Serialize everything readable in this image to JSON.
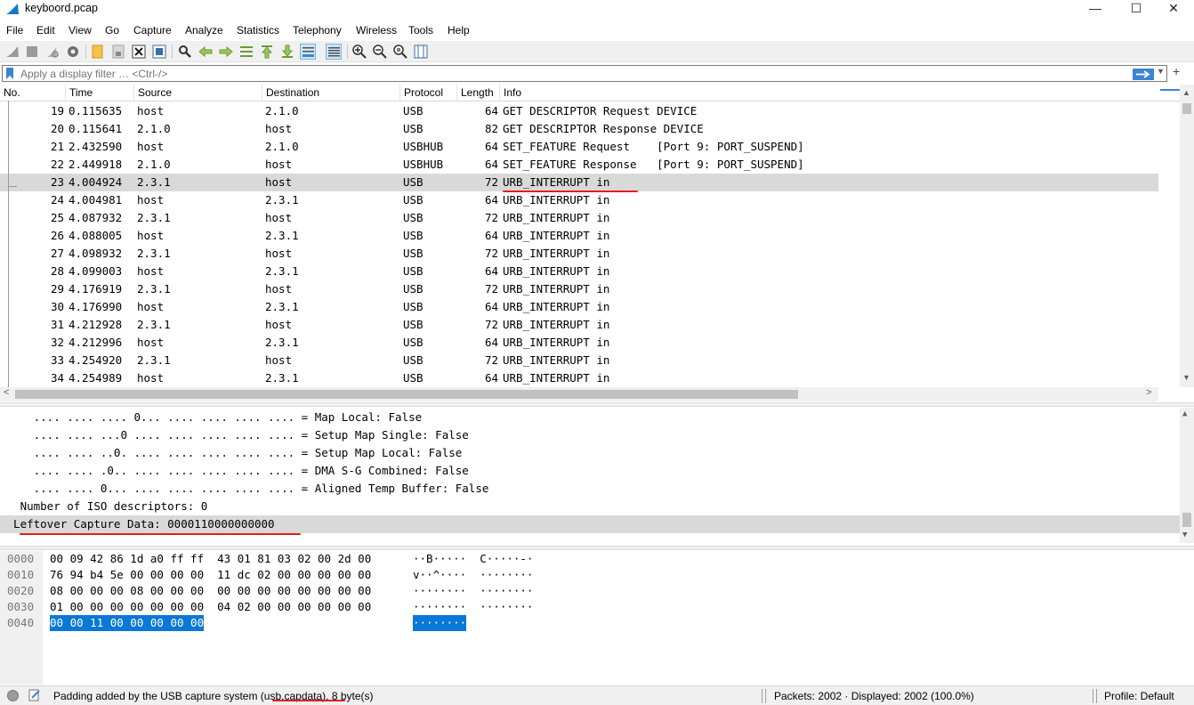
{
  "window": {
    "title": "keyboord.pcap",
    "minimize": "—",
    "maximize": "☐",
    "close": "✕"
  },
  "menu": [
    "File",
    "Edit",
    "View",
    "Go",
    "Capture",
    "Analyze",
    "Statistics",
    "Telephony",
    "Wireless",
    "Tools",
    "Help"
  ],
  "toolbar": {
    "icons": [
      "shark-fin-start-icon",
      "stop-icon",
      "restart-icon",
      "options-gear-icon",
      "open-folder-icon",
      "save-file-icon",
      "close-file-icon",
      "reload-icon",
      "find-icon",
      "go-back-icon",
      "go-forward-icon",
      "go-to-packet-icon",
      "go-first-icon",
      "go-last-icon",
      "autoscroll-icon",
      "colorize-icon",
      "zoom-in-icon",
      "zoom-out-icon",
      "zoom-normal-icon",
      "resize-columns-icon"
    ]
  },
  "filter": {
    "placeholder": "Apply a display filter … <Ctrl-/>",
    "dropdown": "▼",
    "add": "+"
  },
  "packet_list": {
    "columns": [
      "No.",
      "Time",
      "Source",
      "Destination",
      "Protocol",
      "Length",
      "Info"
    ],
    "rows": [
      {
        "no": "19",
        "time": "0.115635",
        "src": "host",
        "dst": "2.1.0",
        "proto": "USB",
        "len": "64",
        "info": "GET DESCRIPTOR Request DEVICE"
      },
      {
        "no": "20",
        "time": "0.115641",
        "src": "2.1.0",
        "dst": "host",
        "proto": "USB",
        "len": "82",
        "info": "GET DESCRIPTOR Response DEVICE"
      },
      {
        "no": "21",
        "time": "2.432590",
        "src": "host",
        "dst": "2.1.0",
        "proto": "USBHUB",
        "len": "64",
        "info": "SET_FEATURE Request    [Port 9: PORT_SUSPEND]"
      },
      {
        "no": "22",
        "time": "2.449918",
        "src": "2.1.0",
        "dst": "host",
        "proto": "USBHUB",
        "len": "64",
        "info": "SET_FEATURE Response   [Port 9: PORT_SUSPEND]"
      },
      {
        "no": "23",
        "time": "4.004924",
        "src": "2.3.1",
        "dst": "host",
        "proto": "USB",
        "len": "72",
        "info": "URB_INTERRUPT in"
      },
      {
        "no": "24",
        "time": "4.004981",
        "src": "host",
        "dst": "2.3.1",
        "proto": "USB",
        "len": "64",
        "info": "URB_INTERRUPT in"
      },
      {
        "no": "25",
        "time": "4.087932",
        "src": "2.3.1",
        "dst": "host",
        "proto": "USB",
        "len": "72",
        "info": "URB_INTERRUPT in"
      },
      {
        "no": "26",
        "time": "4.088005",
        "src": "host",
        "dst": "2.3.1",
        "proto": "USB",
        "len": "64",
        "info": "URB_INTERRUPT in"
      },
      {
        "no": "27",
        "time": "4.098932",
        "src": "2.3.1",
        "dst": "host",
        "proto": "USB",
        "len": "72",
        "info": "URB_INTERRUPT in"
      },
      {
        "no": "28",
        "time": "4.099003",
        "src": "host",
        "dst": "2.3.1",
        "proto": "USB",
        "len": "64",
        "info": "URB_INTERRUPT in"
      },
      {
        "no": "29",
        "time": "4.176919",
        "src": "2.3.1",
        "dst": "host",
        "proto": "USB",
        "len": "72",
        "info": "URB_INTERRUPT in"
      },
      {
        "no": "30",
        "time": "4.176990",
        "src": "host",
        "dst": "2.3.1",
        "proto": "USB",
        "len": "64",
        "info": "URB_INTERRUPT in"
      },
      {
        "no": "31",
        "time": "4.212928",
        "src": "2.3.1",
        "dst": "host",
        "proto": "USB",
        "len": "72",
        "info": "URB_INTERRUPT in"
      },
      {
        "no": "32",
        "time": "4.212996",
        "src": "host",
        "dst": "2.3.1",
        "proto": "USB",
        "len": "64",
        "info": "URB_INTERRUPT in"
      },
      {
        "no": "33",
        "time": "4.254920",
        "src": "2.3.1",
        "dst": "host",
        "proto": "USB",
        "len": "72",
        "info": "URB_INTERRUPT in"
      },
      {
        "no": "34",
        "time": "4.254989",
        "src": "host",
        "dst": "2.3.1",
        "proto": "USB",
        "len": "64",
        "info": "URB_INTERRUPT in"
      }
    ],
    "selected_no": "23"
  },
  "details": {
    "lines": [
      "     .... .... .... 0... .... .... .... .... = Map Local: False",
      "     .... .... ...0 .... .... .... .... .... = Setup Map Single: False",
      "     .... .... ..0. .... .... .... .... .... = Setup Map Local: False",
      "     .... .... .0.. .... .... .... .... .... = DMA S-G Combined: False",
      "     .... .... 0... .... .... .... .... .... = Aligned Temp Buffer: False",
      "   Number of ISO descriptors: 0",
      "  Leftover Capture Data: 0000110000000000"
    ],
    "selected_index": 6
  },
  "hex": {
    "rows": [
      {
        "offset": "0000",
        "hex": "00 09 42 86 1d a0 ff ff  43 01 81 03 02 00 2d 00",
        "ascii": "··B·····  C·····-·"
      },
      {
        "offset": "0010",
        "hex": "76 94 b4 5e 00 00 00 00  11 dc 02 00 00 00 00 00",
        "ascii": "v··^····  ········"
      },
      {
        "offset": "0020",
        "hex": "08 00 00 00 08 00 00 00  00 00 00 00 00 00 00 00",
        "ascii": "········  ········"
      },
      {
        "offset": "0030",
        "hex": "01 00 00 00 00 00 00 00  04 02 00 00 00 00 00 00",
        "ascii": "········  ········"
      },
      {
        "offset": "0040",
        "hex": "00 00 11 00 00 00 00 00",
        "ascii": "········"
      }
    ],
    "selected_row": 4
  },
  "status": {
    "field_info": "Padding added by the USB capture system (usb.capdata), 8 byte(s)",
    "packets": "Packets: 2002 · Displayed: 2002 (100.0%)",
    "profile": "Profile: Default"
  },
  "colors": {
    "selection_gray": "#d9d9d9",
    "hex_highlight": "#0a78d7",
    "annotation_red": "#e0201a",
    "apply_blue": "#3c83d4"
  }
}
